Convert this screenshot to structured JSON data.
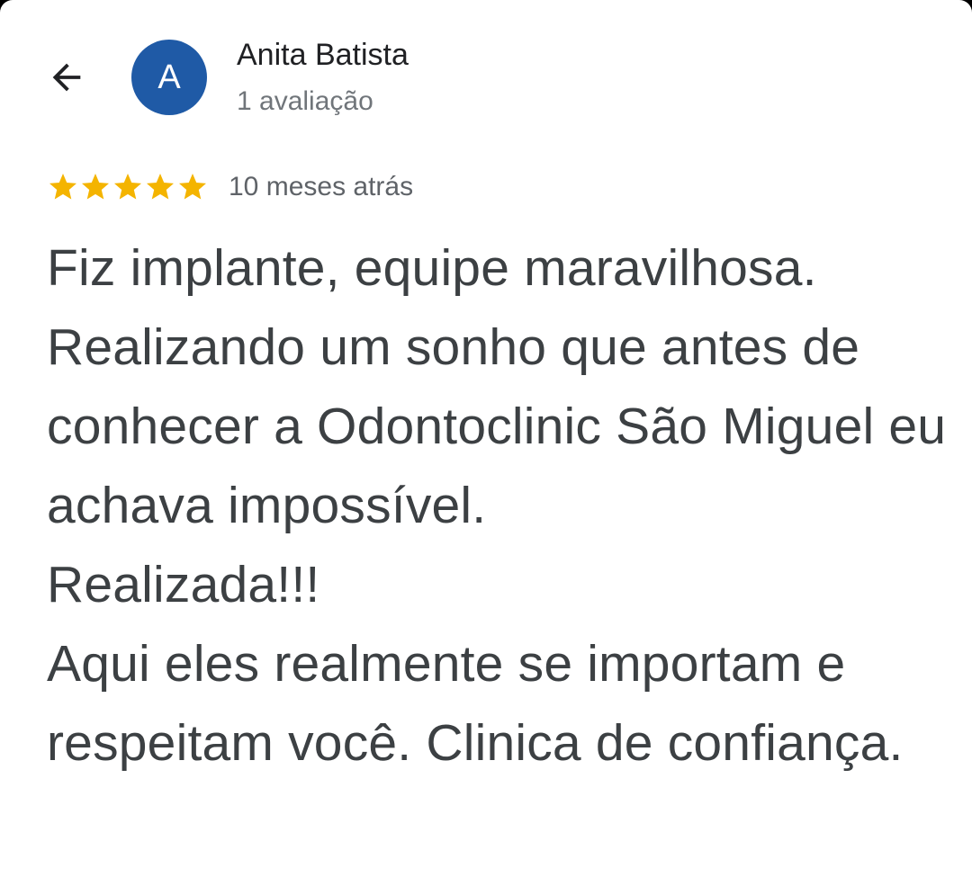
{
  "reviewer": {
    "avatar_letter": "A",
    "avatar_color": "#1f5aa6",
    "name": "Anita Batista",
    "review_count": "1 avaliação"
  },
  "navigation": {
    "back_icon": "arrow-back-icon"
  },
  "review": {
    "rating": 5,
    "max_rating": 5,
    "star_color": "#f4b400",
    "time": "10 meses atrás",
    "text": "Fiz implante, equipe maravilhosa. Realizando um sonho que antes de conhecer a Odontoclinic São Miguel eu achava impossível.\nRealizada!!!\nAqui eles realmente se importam e respeitam você. Clinica de confiança."
  }
}
